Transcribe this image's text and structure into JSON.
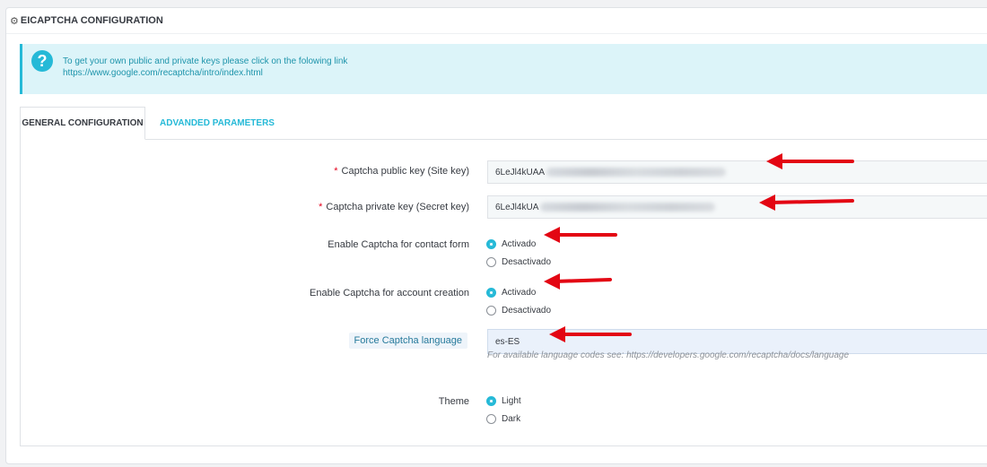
{
  "header": {
    "title": "EICAPTCHA CONFIGURATION",
    "icon": "gears-icon"
  },
  "info": {
    "icon": "question-circle-icon",
    "line1": "To get your own public and private keys please click on the folowing link",
    "link": "https://www.google.com/recaptcha/intro/index.html"
  },
  "tabs": [
    {
      "label": "GENERAL CONFIGURATION",
      "active": true
    },
    {
      "label": "ADVANDED PARAMETERS",
      "active": false
    }
  ],
  "form": {
    "public_key": {
      "required_mark": "*",
      "label": "Captcha public key (Site key)",
      "value": "6LeJl4kUAA"
    },
    "private_key": {
      "required_mark": "*",
      "label": "Captcha private key (Secret key)",
      "value": "6LeJl4kUA"
    },
    "contact_form": {
      "label": "Enable Captcha for contact form",
      "options": [
        "Activado",
        "Desactivado"
      ],
      "selected": "Activado"
    },
    "account_creation": {
      "label": "Enable Captcha for account creation",
      "options": [
        "Activado",
        "Desactivado"
      ],
      "selected": "Activado"
    },
    "force_language": {
      "label": "Force Captcha language",
      "value": "es-ES",
      "help": "For available language codes see: https://developers.google.com/recaptcha/docs/language"
    },
    "theme": {
      "label": "Theme",
      "options": [
        "Light",
        "Dark"
      ],
      "selected": "Light"
    }
  },
  "colors": {
    "accent": "#25b9d7",
    "required": "#e5001c",
    "annotation_arrow": "#e30613",
    "info_bg": "#dcf4f9"
  }
}
